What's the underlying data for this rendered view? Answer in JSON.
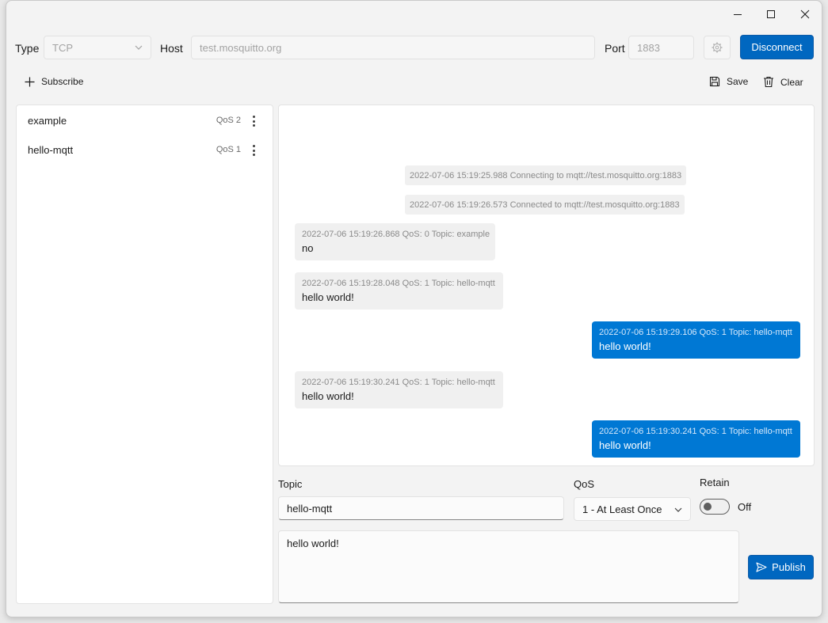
{
  "window": {
    "controls": [
      "minimize-icon",
      "maximize-icon",
      "close-icon"
    ]
  },
  "connection": {
    "type_label": "Type",
    "type_value": "TCP",
    "host_label": "Host",
    "host_value": "test.mosquitto.org",
    "port_label": "Port",
    "port_value": "1883",
    "disconnect_label": "Disconnect"
  },
  "toolbar": {
    "subscribe_label": "Subscribe",
    "save_label": "Save",
    "clear_label": "Clear"
  },
  "subscriptions": [
    {
      "name": "example",
      "qos": "QoS 2"
    },
    {
      "name": "hello-mqtt",
      "qos": "QoS 1"
    }
  ],
  "log": [
    "2022-07-06 15:19:25.988 Connecting to mqtt://test.mosquitto.org:1883",
    "2022-07-06 15:19:26.573 Connected to mqtt://test.mosquitto.org:1883"
  ],
  "messages": [
    {
      "direction": "in",
      "meta": "2022-07-06 15:19:26.868 QoS: 0 Topic: example",
      "body": "no"
    },
    {
      "direction": "in",
      "meta": "2022-07-06 15:19:28.048 QoS: 1 Topic: hello-mqtt",
      "body": "hello world!"
    },
    {
      "direction": "out",
      "meta": "2022-07-06 15:19:29.106 QoS: 1 Topic: hello-mqtt",
      "body": "hello world!"
    },
    {
      "direction": "in",
      "meta": "2022-07-06 15:19:30.241 QoS: 1 Topic: hello-mqtt",
      "body": "hello world!"
    },
    {
      "direction": "out",
      "meta": "2022-07-06 15:19:30.241 QoS: 1 Topic: hello-mqtt",
      "body": "hello world!"
    }
  ],
  "publish": {
    "topic_label": "Topic",
    "topic_value": "hello-mqtt",
    "qos_label": "QoS",
    "qos_value": "1 - At Least Once",
    "retain_label": "Retain",
    "retain_state": "Off",
    "payload": "hello world!",
    "publish_label": "Publish"
  },
  "colors": {
    "accent": "#0067c0",
    "outgoing_bubble": "#0078d4",
    "incoming_bubble": "#f0f0f0"
  }
}
